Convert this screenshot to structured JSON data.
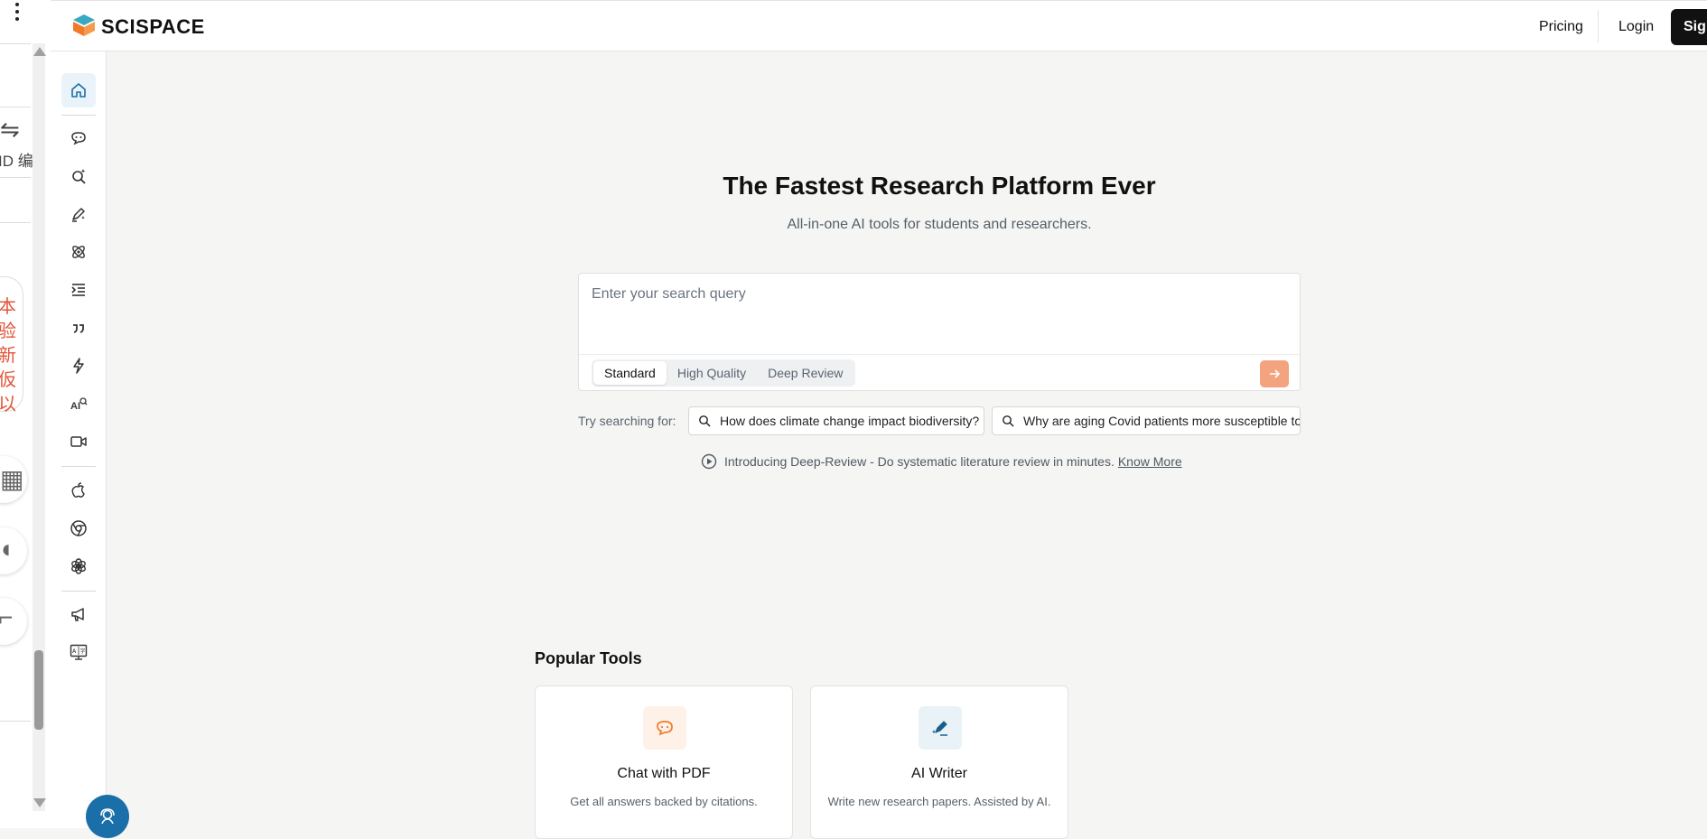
{
  "left_panel": {
    "text_1": "⇋",
    "text_2": "ID 编",
    "orange_text": "本\n验\n新\n仮\n以"
  },
  "header": {
    "logo_text": "SCISPACE",
    "pricing": "Pricing",
    "login": "Login",
    "signup": "Sign up"
  },
  "hero": {
    "title": "The Fastest Research Platform Ever",
    "subtitle": "All-in-one AI tools for students and researchers."
  },
  "search": {
    "placeholder": "Enter your search query",
    "modes": [
      "Standard",
      "High Quality",
      "Deep Review"
    ],
    "active_mode": "Standard"
  },
  "suggestions": {
    "label": "Try searching for:",
    "items": [
      "How does climate change impact biodiversity?",
      "Why are aging Covid patients more susceptible to"
    ]
  },
  "intro": {
    "text": "Introducing Deep-Review - Do systematic literature review in minutes.",
    "link": "Know More"
  },
  "popular": {
    "heading": "Popular Tools",
    "cards": [
      {
        "title": "Chat with PDF",
        "desc": "Get all answers backed by citations.",
        "icon": "chat-bubble-icon",
        "color": "#f07a2a"
      },
      {
        "title": "AI Writer",
        "desc": "Write new research papers. Assisted by AI.",
        "icon": "pen-sparkle-icon",
        "color": "#1a5f8a"
      }
    ]
  },
  "colors": {
    "accent_orange": "#f4a37f",
    "brand_blue": "#1a6fa8",
    "active_nav_bg": "#e9f3f9"
  }
}
